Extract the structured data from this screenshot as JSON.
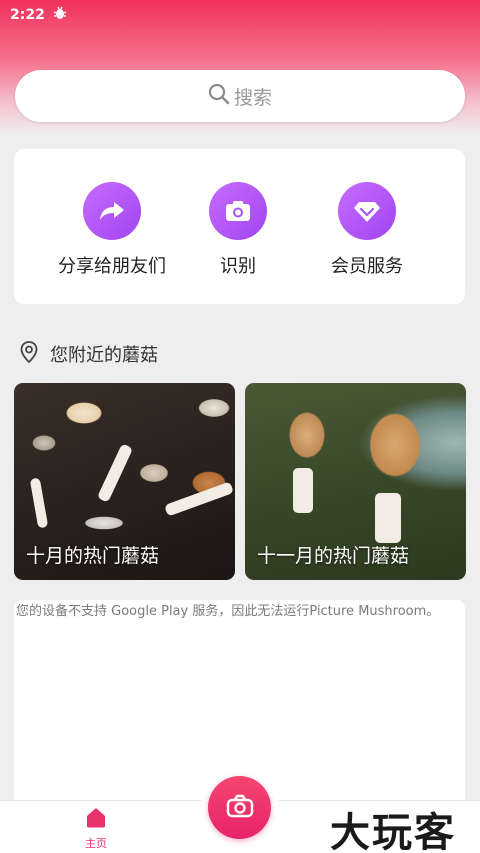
{
  "status_bar": {
    "time": "2:22",
    "notification_icon": "bug-icon"
  },
  "search": {
    "placeholder": "搜索",
    "icon": "search-icon"
  },
  "actions": [
    {
      "label": "分享给朋友们",
      "icon": "share-arrow-icon"
    },
    {
      "label": "识别",
      "icon": "camera-icon"
    },
    {
      "label": "会员服务",
      "icon": "diamond-icon"
    }
  ],
  "nearby": {
    "title": "您附近的蘑菇",
    "icon": "location-pin-icon"
  },
  "tiles": [
    {
      "caption": "十月的热门蘑菇"
    },
    {
      "caption": "十一月的热门蘑菇"
    }
  ],
  "message": {
    "text": "您的设备不支持 Google Play 服务，因此无法运行Picture Mushroom。"
  },
  "bottom_nav": {
    "home_label": "主页",
    "home_icon": "home-icon",
    "camera_icon": "camera-icon"
  },
  "watermark": {
    "text": "大玩客"
  },
  "colors": {
    "accent": "#e8336b",
    "purple": "#a855f7"
  }
}
